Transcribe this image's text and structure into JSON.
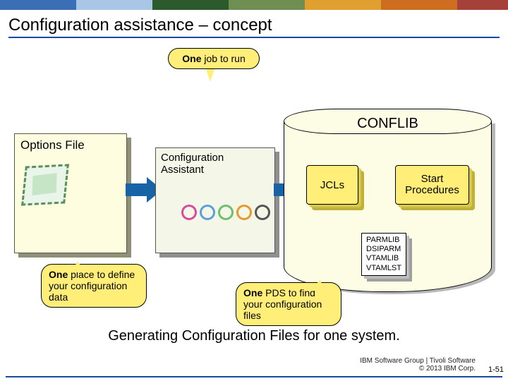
{
  "slide": {
    "title": "Configuration assistance – concept",
    "subtitle": "Generating Configuration Files for one system."
  },
  "callouts": {
    "one_job": {
      "bold": "One",
      "rest": " job  to run"
    },
    "one_place": {
      "bold": "One",
      "rest": " place to define your configuration data"
    },
    "one_pds": {
      "bold": "One",
      "rest": " PDS to find your configuration files"
    }
  },
  "options_file": {
    "label": "Options File"
  },
  "config_assistant": {
    "label_line1": "Configuration",
    "label_line2": "Assistant"
  },
  "conflib": {
    "label": "CONFLIB",
    "jcls": "JCLs",
    "start_procs_line1": "Start",
    "start_procs_line2": "Procedures",
    "libs": [
      "PARMLIB",
      "DSIPARM",
      "VTAMLIB",
      "VTAMLST"
    ]
  },
  "footer": {
    "line1": "IBM Software Group | Tivoli Software",
    "line2": "© 2013 IBM Corp.",
    "page": "1-51"
  }
}
